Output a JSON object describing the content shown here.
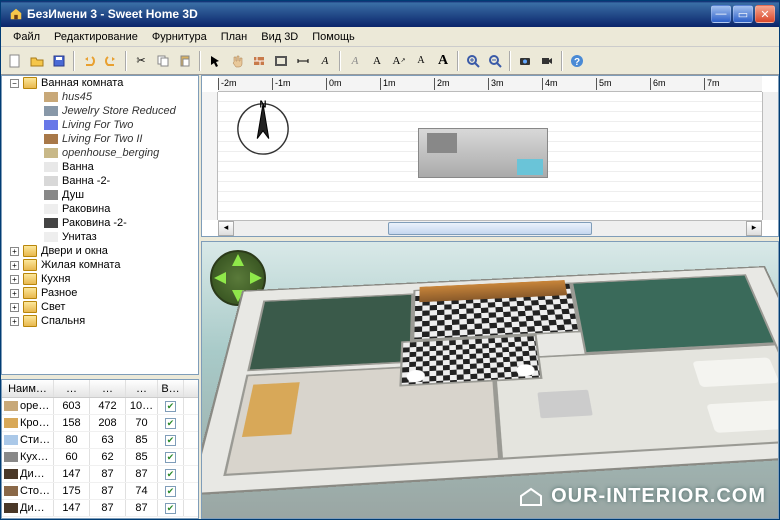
{
  "window": {
    "title": "БезИмени 3 - Sweet Home 3D"
  },
  "menu": [
    "Файл",
    "Редактирование",
    "Фурнитура",
    "План",
    "Вид 3D",
    "Помощь"
  ],
  "toolbar_icons": [
    "new-file",
    "open-file",
    "save",
    "spacer",
    "undo",
    "redo",
    "spacer",
    "cut",
    "copy",
    "paste",
    "spacer",
    "pointer",
    "pan",
    "wall",
    "room",
    "dimension",
    "text-label",
    "spacer",
    "text-a-italic",
    "text-a",
    "text-a-arrow",
    "text-a-plain",
    "text-A-big",
    "spacer",
    "zoom-in",
    "zoom-out",
    "spacer",
    "camera",
    "record",
    "spacer",
    "help"
  ],
  "tree": {
    "root": "Ванная комната",
    "catalog_items": [
      "hus45",
      "Jewelry Store Reduced",
      "Living For Two",
      "Living For Two II",
      "openhouse_berging"
    ],
    "fixtures": [
      "Ванна",
      "Ванна -2-",
      "Душ",
      "Раковина",
      "Раковина -2-",
      "Унитаз"
    ],
    "categories": [
      "Двери и окна",
      "Жилая комната",
      "Кухня",
      "Разное",
      "Свет",
      "Спальня"
    ]
  },
  "table": {
    "headers": [
      "Наим…",
      "…",
      "…",
      "…",
      "В…"
    ],
    "rows": [
      {
        "name": "оре…",
        "w": "603",
        "d": "472",
        "h": "10…",
        "vis": true
      },
      {
        "name": "Кро…",
        "w": "158",
        "d": "208",
        "h": "70",
        "vis": true
      },
      {
        "name": "Сти…",
        "w": "80",
        "d": "63",
        "h": "85",
        "vis": true
      },
      {
        "name": "Кух…",
        "w": "60",
        "d": "62",
        "h": "85",
        "vis": true
      },
      {
        "name": "Ди…",
        "w": "147",
        "d": "87",
        "h": "87",
        "vis": true
      },
      {
        "name": "Сто…",
        "w": "175",
        "d": "87",
        "h": "74",
        "vis": true
      },
      {
        "name": "Ди…",
        "w": "147",
        "d": "87",
        "h": "87",
        "vis": true
      }
    ]
  },
  "ruler_ticks": [
    "-2m",
    "-1m",
    "0m",
    "1m",
    "2m",
    "3m",
    "4m",
    "5m",
    "6m",
    "7m"
  ],
  "compass_label": "N",
  "watermark": "OUR-INTERIOR.COM"
}
